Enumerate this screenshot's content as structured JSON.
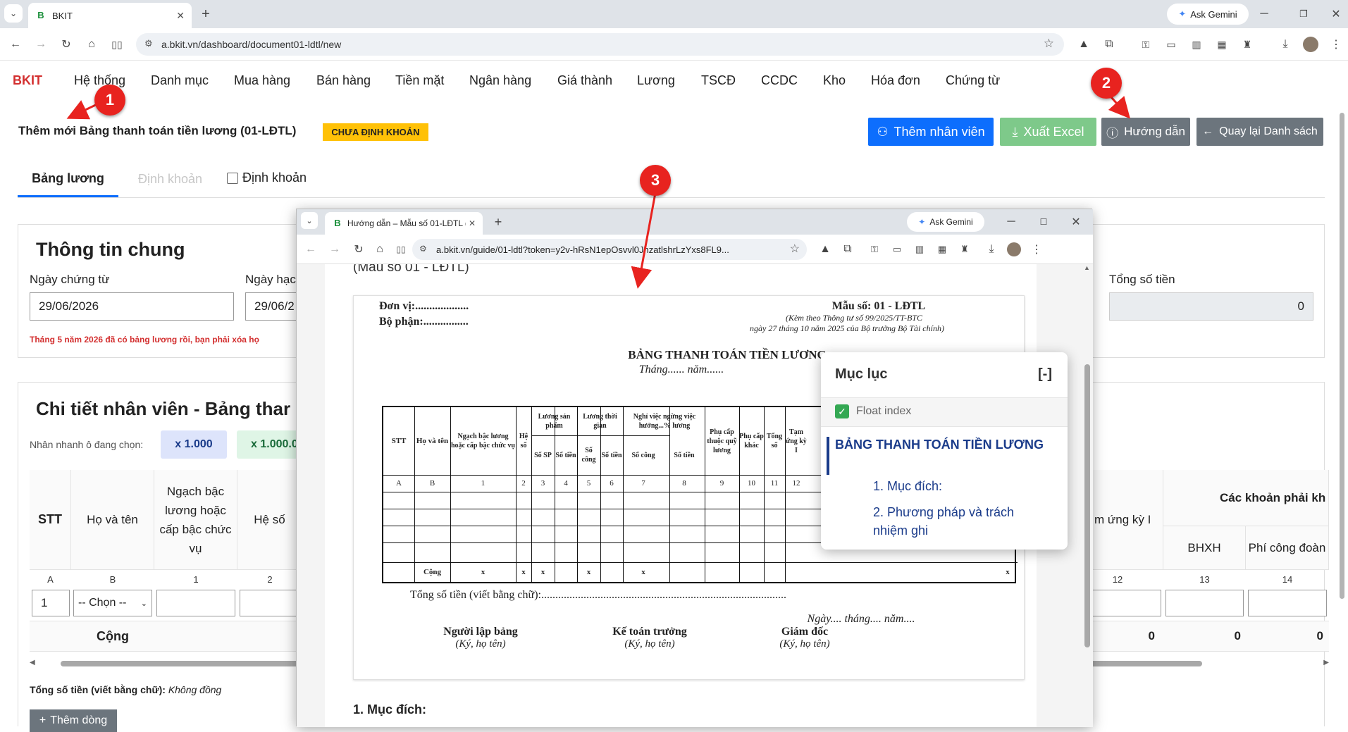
{
  "browser": {
    "tab_title": "BKIT",
    "favicon_letter": "B",
    "url": "a.bkit.vn/dashboard/document01-ldtl/new",
    "ask_gemini": "Ask Gemini"
  },
  "app": {
    "brand": "BKIT",
    "nav": [
      "Hệ thống",
      "Danh mục",
      "Mua hàng",
      "Bán hàng",
      "Tiền mặt",
      "Ngân hàng",
      "Giá thành",
      "Lương",
      "TSCĐ",
      "CCDC",
      "Kho",
      "Hóa đơn",
      "Chứng từ"
    ],
    "page_title": "Thêm mới Bảng thanh toán tiền lương (01-LĐTL)",
    "status_badge": "CHƯA ĐỊNH KHOẢN",
    "buttons": {
      "add_employee": "Thêm nhân viên",
      "export_excel": "Xuất Excel",
      "guide": "Hướng dẫn",
      "back": "Quay lại Danh sách"
    },
    "buttons_colors": {
      "add_employee": "#0d6efd",
      "export_excel": "#7ec98a",
      "guide": "#6c757d",
      "back": "#6c757d"
    },
    "tabs": {
      "salary": "Bảng lương",
      "posting": "Định khoản",
      "posting_checkbox": "Định khoản"
    },
    "general": {
      "title": "Thông tin chung",
      "date_label": "Ngày chứng từ",
      "date_value": "29/06/2026",
      "date2_label": "Ngày hạc",
      "date2_value": "29/06/2",
      "total_label": "Tổng số tiền",
      "total_value": "0",
      "warning": "Tháng 5 năm 2026 đã có bảng lương rồi, bạn phải xóa họ"
    },
    "detail": {
      "title": "Chi tiết nhân viên - Bảng thar",
      "quick_label": "Nhân nhanh ô đang chọn:",
      "quick_btn1": "x 1.000",
      "quick_btn2": "x 1.000.0",
      "headers": {
        "stt": "STT",
        "name": "Họ và tên",
        "grade": "Ngạch bậc lương hoặc cấp bậc chức vụ",
        "coef": "Hệ số",
        "advance": "m ứng kỳ I",
        "deductions": "Các khoản phải kh",
        "bhxh": "BHXH",
        "union": "Phí công đoàn"
      },
      "col_nums": [
        "A",
        "B",
        "1",
        "2",
        "12",
        "13",
        "14"
      ],
      "row1_stt": "1",
      "row1_select": "-- Chọn --",
      "total_label": "Cộng",
      "totals": [
        "0",
        "0",
        "0"
      ],
      "words_label": "Tổng số tiền (viết bằng chữ):",
      "words_value": "Không đồng",
      "add_row": "Thêm dòng"
    }
  },
  "popup": {
    "tab_title": "Hướng dẫn – Mẫu số 01-LĐTL (",
    "url": "a.bkit.vn/guide/01-ldtl?token=y2v-hRsN1epOsvvl0JhzatlshrLzYxs8FL9...",
    "ask_gemini": "Ask Gemini",
    "heading_cut": "(Mẫu số 01 - LĐTL)",
    "form": {
      "unit": "Đơn vị:...................",
      "dept": "Bộ phận:................",
      "form_no": "Mẫu số: 01 - LĐTL",
      "circular": "(Kèm theo Thông tư số 99/2025/TT-BTC",
      "circular2": "ngày 27 tháng 10 năm 2025 của Bộ trưởng Bộ Tài chính)",
      "title": "BẢNG THANH TOÁN TIỀN LƯƠNG",
      "period": "Tháng...... năm......",
      "col_headers": [
        "STT",
        "Họ và tên",
        "Ngạch bậc lương hoặc cấp bậc chức vụ",
        "Hệ số",
        "Lương sản phẩm",
        "Lương thời gian",
        "Nghỉ việc ngừng việc hưởng...% lương",
        "Phụ cấp thuộc quỹ lương",
        "Phụ cấp khác",
        "Tổng số",
        "Tạm ứng kỳ I"
      ],
      "sub_headers": [
        "Số SP",
        "Số tiền",
        "Số công",
        "Số tiền",
        "Số công",
        "Số tiền"
      ],
      "col_codes": [
        "A",
        "B",
        "1",
        "2",
        "3",
        "4",
        "5",
        "6",
        "7",
        "8",
        "9",
        "10",
        "11",
        "12"
      ],
      "total_row": "Cộng",
      "x_mark": "x",
      "in_words": "Tổng số tiền (viết bằng chữ):.......................................................................................",
      "date_line": "Ngày.... tháng.... năm....",
      "sig1": "Người lập bảng",
      "sig1_sub": "(Ký, họ tên)",
      "sig2": "Kế toán trưởng",
      "sig2_sub": "(Ký, họ tên)",
      "sig3": "Giám đốc",
      "sig3_sub": "(Ký, họ tên)"
    },
    "section1": "1. Mục đích:",
    "toc": {
      "title": "Mục lục",
      "collapse": "[-]",
      "float_label": "Float index",
      "main": "BẢNG THANH TOÁN TIỀN LƯƠNG",
      "items": [
        "1. Mục đích:",
        "2. Phương pháp và trách nhiệm ghi"
      ]
    }
  },
  "annotations": [
    "1",
    "2",
    "3"
  ],
  "colors": {
    "brand": "#d32f2f",
    "primary": "#0d6efd",
    "warning": "#ffc107",
    "annotation": "#e8231f",
    "toc_accent": "#1a3b8a"
  }
}
